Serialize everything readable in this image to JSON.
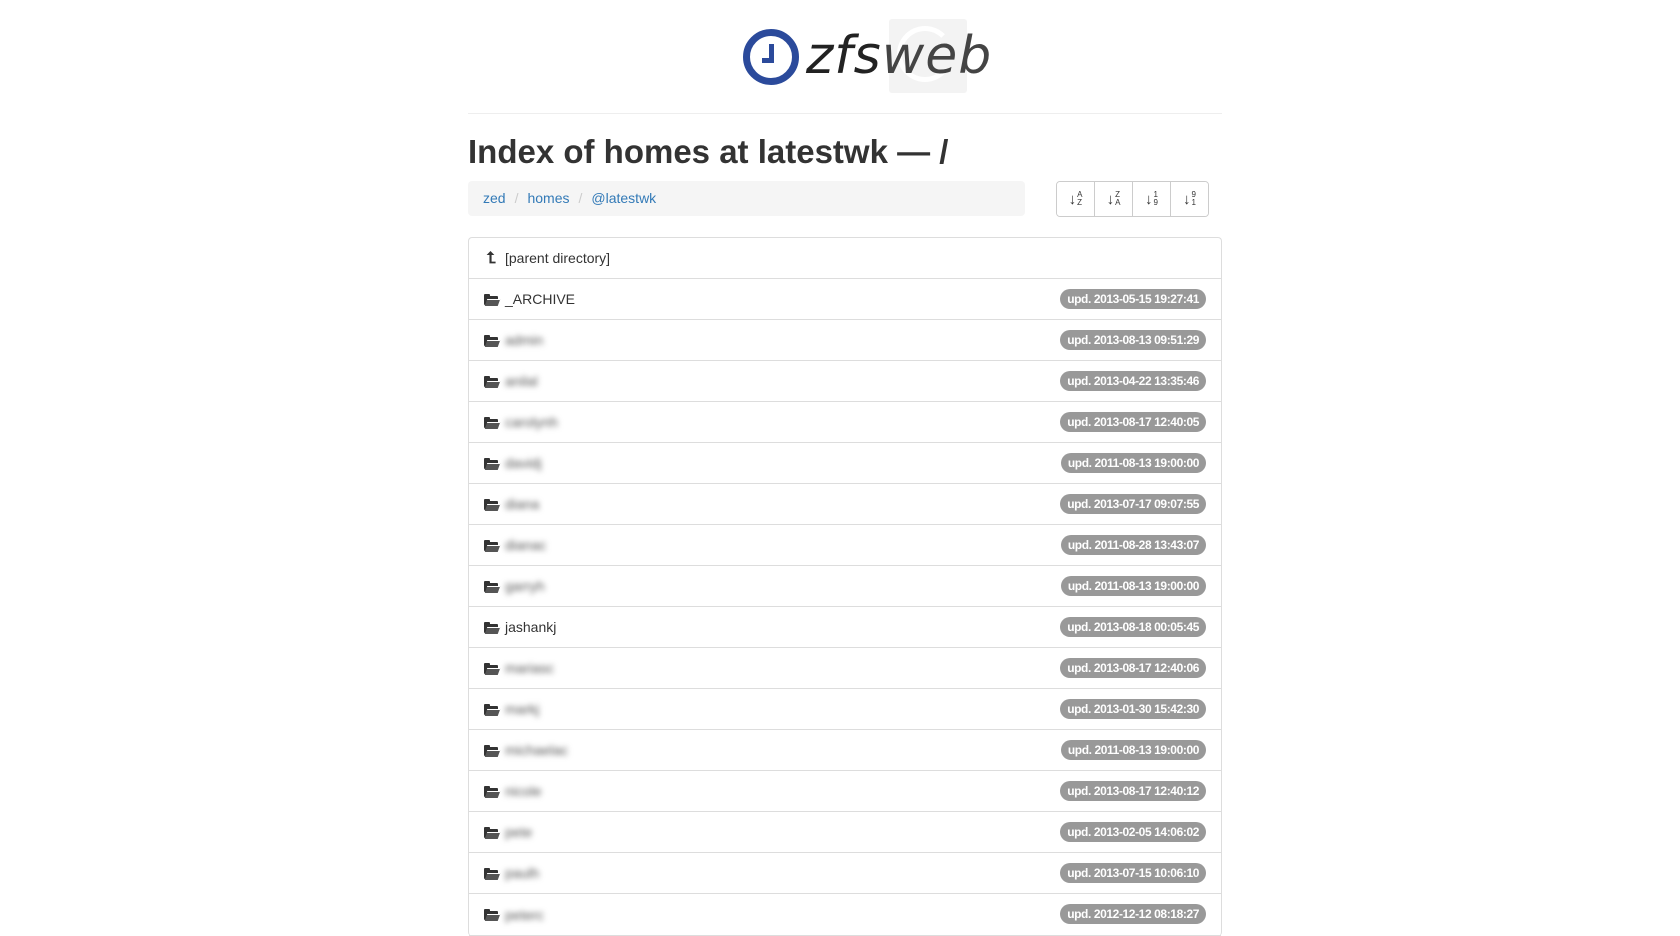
{
  "logo": {
    "text_main": "zfs",
    "text_sub": "web"
  },
  "page_title": "Index of homes at latestwk — /",
  "breadcrumb": [
    {
      "label": "zed"
    },
    {
      "label": "homes"
    },
    {
      "label": "@latestwk"
    }
  ],
  "breadcrumb_separator": "/",
  "sort_buttons": [
    {
      "top": "A",
      "bottom": "Z",
      "name": "sort-name-asc-button"
    },
    {
      "top": "Z",
      "bottom": "A",
      "name": "sort-name-desc-button"
    },
    {
      "top": "1",
      "bottom": "9",
      "name": "sort-date-asc-button"
    },
    {
      "top": "9",
      "bottom": "1",
      "name": "sort-date-desc-button"
    }
  ],
  "parent_entry": {
    "label": "[parent directory]",
    "icon": "level-up-icon"
  },
  "entries": [
    {
      "name": "_ARCHIVE",
      "updated": "upd. 2013-05-15 19:27:41",
      "blurred": false,
      "icon": "folder-open-icon"
    },
    {
      "name": "admin",
      "updated": "upd. 2013-08-13 09:51:29",
      "blurred": true,
      "icon": "folder-open-icon"
    },
    {
      "name": "anilal",
      "updated": "upd. 2013-04-22 13:35:46",
      "blurred": true,
      "icon": "folder-open-icon"
    },
    {
      "name": "carolynh",
      "updated": "upd. 2013-08-17 12:40:05",
      "blurred": true,
      "icon": "folder-open-icon"
    },
    {
      "name": "davidj",
      "updated": "upd. 2011-08-13 19:00:00",
      "blurred": true,
      "icon": "folder-open-icon"
    },
    {
      "name": "diana",
      "updated": "upd. 2013-07-17 09:07:55",
      "blurred": true,
      "icon": "folder-open-icon"
    },
    {
      "name": "dianac",
      "updated": "upd. 2011-08-28 13:43:07",
      "blurred": true,
      "icon": "folder-open-icon"
    },
    {
      "name": "garryh",
      "updated": "upd. 2011-08-13 19:00:00",
      "blurred": true,
      "icon": "folder-open-icon"
    },
    {
      "name": "jashankj",
      "updated": "upd. 2013-08-18 00:05:45",
      "blurred": false,
      "icon": "folder-open-icon"
    },
    {
      "name": "mariasc",
      "updated": "upd. 2013-08-17 12:40:06",
      "blurred": true,
      "icon": "folder-open-icon"
    },
    {
      "name": "markj",
      "updated": "upd. 2013-01-30 15:42:30",
      "blurred": true,
      "icon": "folder-open-icon"
    },
    {
      "name": "michaelac",
      "updated": "upd. 2011-08-13 19:00:00",
      "blurred": true,
      "icon": "folder-open-icon"
    },
    {
      "name": "nicole",
      "updated": "upd. 2013-08-17 12:40:12",
      "blurred": true,
      "icon": "folder-open-icon"
    },
    {
      "name": "pete",
      "updated": "upd. 2013-02-05 14:06:02",
      "blurred": true,
      "icon": "folder-open-icon"
    },
    {
      "name": "paulh",
      "updated": "upd. 2013-07-15 10:06:10",
      "blurred": true,
      "icon": "folder-open-icon"
    },
    {
      "name": "peterc",
      "updated": "upd. 2012-12-12 08:18:27",
      "blurred": true,
      "icon": "folder-open-icon"
    }
  ],
  "colors": {
    "brand_blue": "#2b4a9b",
    "link": "#337ab7",
    "badge_bg": "#999999",
    "breadcrumb_bg": "#f5f5f5"
  }
}
